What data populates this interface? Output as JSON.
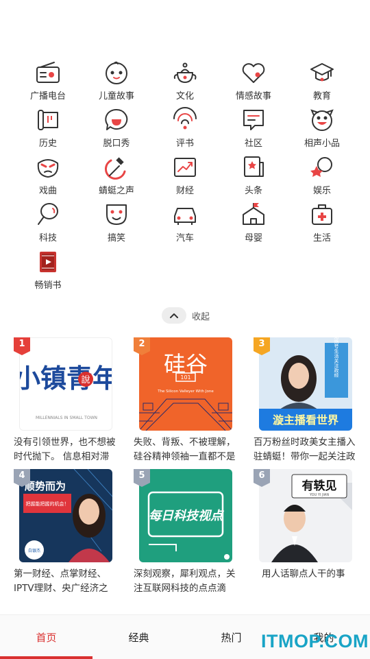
{
  "categories": [
    {
      "label": "广播电台",
      "icon": "radio-icon"
    },
    {
      "label": "儿童故事",
      "icon": "child-face-icon"
    },
    {
      "label": "文化",
      "icon": "teapot-icon"
    },
    {
      "label": "情感故事",
      "icon": "heart-icon"
    },
    {
      "label": "教育",
      "icon": "graduation-cap-icon"
    },
    {
      "label": "历史",
      "icon": "scroll-icon"
    },
    {
      "label": "脱口秀",
      "icon": "talk-bubble-icon"
    },
    {
      "label": "评书",
      "icon": "folding-fan-icon"
    },
    {
      "label": "社区",
      "icon": "chat-bubble-icon"
    },
    {
      "label": "相声小品",
      "icon": "smiling-face-icon"
    },
    {
      "label": "戏曲",
      "icon": "opera-mask-icon"
    },
    {
      "label": "蜻蜓之声",
      "icon": "hammer-sickle-icon"
    },
    {
      "label": "财经",
      "icon": "trend-chart-icon"
    },
    {
      "label": "头条",
      "icon": "news-star-icon"
    },
    {
      "label": "娱乐",
      "icon": "star-burst-icon"
    },
    {
      "label": "科技",
      "icon": "balloon-icon"
    },
    {
      "label": "搞笑",
      "icon": "funny-face-icon"
    },
    {
      "label": "汽车",
      "icon": "car-icon"
    },
    {
      "label": "母婴",
      "icon": "house-flag-icon"
    },
    {
      "label": "生活",
      "icon": "medical-kit-icon"
    },
    {
      "label": "畅销书",
      "icon": "book-icon"
    }
  ],
  "collapse_label": "收起",
  "ranks": [
    {
      "rank": "1",
      "badge_color": "#e5403a",
      "cover_title": "小镇青年",
      "cover_sub": "MILLENNIALS IN SMALL TOWN",
      "cover_stamp": "說",
      "desc": "没有引领世界，也不想被时代抛下。 信息相对滞后，但并不孤陋寡闻。"
    },
    {
      "rank": "2",
      "badge_color": "#f07f3a",
      "cover_title": "硅谷",
      "cover_mark": "101",
      "cover_sub": "The Silicon Valleyer With Jone",
      "desc": "失败、背叛、不被理解，硅谷精神领袖一直都不是完美的存在：他们"
    },
    {
      "rank": "3",
      "badge_color": "#f5a623",
      "cover_title": "漩主播看世界",
      "cover_side": "月认知扬号生活关注政经",
      "desc": "百万粉丝时政美女主播入驻蜻蜓！带你一起关注政经，用认知指导生活"
    },
    {
      "rank": "4",
      "badge_color": "#9aa4b5",
      "cover_title": "顺势而为",
      "cover_sub": "把握能把握的机会！",
      "cover_logo": "白银杰",
      "desc": "第一财经、点掌财经、IPTV理财、央广经济之声等多家知名栏目特约"
    },
    {
      "rank": "5",
      "badge_color": "#9aa4b5",
      "cover_title": "每日科技视点",
      "desc": "深刻观察，犀利观点，关注互联网科技的点点滴滴。 主播：陌然"
    },
    {
      "rank": "6",
      "badge_color": "#9aa4b5",
      "cover_title": "有轶见",
      "cover_sub": "YOU YI JIAN",
      "desc": "用人话聊点人干的事"
    }
  ],
  "nav": [
    {
      "label": "首页",
      "active": true
    },
    {
      "label": "经典",
      "active": false
    },
    {
      "label": "热门",
      "active": false
    },
    {
      "label": "我的",
      "active": false
    }
  ],
  "accent": "#d9302f",
  "watermark": "ITMOP.COM"
}
